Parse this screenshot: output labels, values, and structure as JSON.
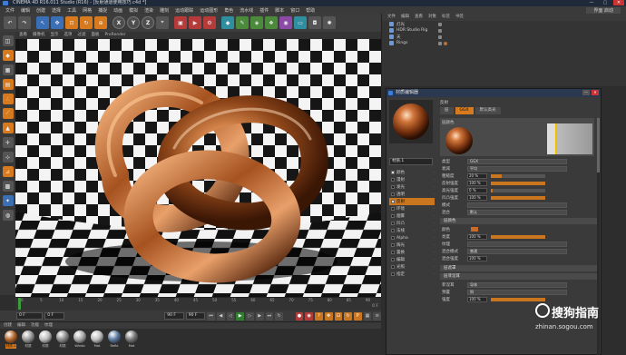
{
  "app": {
    "title": "CINEMA 4D R16.011 Studio (R16) - [反射通道使用技巧.c4d *]",
    "win_buttons": [
      "—",
      "▢",
      "✕"
    ]
  },
  "menu": {
    "items": [
      "文件",
      "编辑",
      "创建",
      "选择",
      "工具",
      "网格",
      "捕捉",
      "动画",
      "模拟",
      "渲染",
      "雕刻",
      "运动跟踪",
      "运动图形",
      "角色",
      "流水线",
      "插件",
      "脚本",
      "窗口",
      "帮助"
    ],
    "layout_label": "界面",
    "layout_value": "启动"
  },
  "toolbar": {
    "axis_x": "X",
    "axis_y": "Y",
    "axis_z": "Z"
  },
  "viewport": {
    "menu": [
      "查看",
      "摄像机",
      "显示",
      "选项",
      "过滤",
      "面板",
      "ProRender"
    ]
  },
  "timeline": {
    "ticks": [
      "0",
      "5",
      "10",
      "15",
      "20",
      "25",
      "30",
      "35",
      "40",
      "45",
      "50",
      "55",
      "60",
      "65",
      "70",
      "75",
      "80",
      "85",
      "90"
    ],
    "end_label": "0 F"
  },
  "transport": {
    "start": "0 F",
    "current": "0 F",
    "end": "90 F",
    "end2": "90 F"
  },
  "materials": {
    "menu": [
      "创建",
      "编辑",
      "功能",
      "纹理"
    ],
    "items": [
      {
        "label": "材质.1",
        "color": "#b5672a",
        "selected": true
      },
      {
        "label": "材质",
        "color": "#9a9a9a",
        "selected": false
      },
      {
        "label": "材质",
        "color": "#bdbdbd",
        "selected": false
      },
      {
        "label": "材质",
        "color": "#8c8c8c",
        "selected": false
      },
      {
        "label": "Windo",
        "color": "#a8a8a8",
        "selected": false
      },
      {
        "label": "Mat",
        "color": "#c0c0c0",
        "selected": false
      },
      {
        "label": "Refle",
        "color": "#5a7aa0",
        "selected": false
      },
      {
        "label": "Mat",
        "color": "#777777",
        "selected": false
      }
    ]
  },
  "objects": {
    "menu": [
      "文件",
      "编辑",
      "查看",
      "对象",
      "标签",
      "书签"
    ],
    "rows": [
      {
        "label": "灯光"
      },
      {
        "label": "HDR Studio Rig"
      },
      {
        "label": "天"
      },
      {
        "label": "Rings"
      }
    ]
  },
  "material_editor": {
    "title": "材质编辑器",
    "material_name": "材质.1",
    "channels": [
      {
        "label": "颜色",
        "on": true,
        "sel": false
      },
      {
        "label": "漫射",
        "on": false,
        "sel": false
      },
      {
        "label": "发光",
        "on": false,
        "sel": false
      },
      {
        "label": "透明",
        "on": false,
        "sel": false
      },
      {
        "label": "反射",
        "on": true,
        "sel": true
      },
      {
        "label": "环境",
        "on": false,
        "sel": false
      },
      {
        "label": "烟雾",
        "on": false,
        "sel": false
      },
      {
        "label": "凹凸",
        "on": false,
        "sel": false
      },
      {
        "label": "法线",
        "on": false,
        "sel": false
      },
      {
        "label": "Alpha",
        "on": false,
        "sel": false
      },
      {
        "label": "辉光",
        "on": false,
        "sel": false
      },
      {
        "label": "置换",
        "on": false,
        "sel": false
      },
      {
        "label": "编辑",
        "on": false,
        "sel": false
      },
      {
        "label": "光照",
        "on": false,
        "sel": false
      },
      {
        "label": "指定",
        "on": false,
        "sel": false
      }
    ],
    "attr_title": "反射",
    "tabs": [
      "层",
      "GGX",
      "默认高光"
    ],
    "layer_label": "层颜色",
    "rows": {
      "type_label": "类型",
      "type_value": "GGX",
      "atten_label": "衰减",
      "atten_value": "平均",
      "rough_label": "粗糙度",
      "rough_value": "20 %",
      "refl_label": "反射强度",
      "refl_value": "100 %",
      "spec_label": "高光强度",
      "spec_value": "0 %",
      "bump_label": "凹凸强度",
      "bump_value": "100 %",
      "mode_label": "模式",
      "mode_value": "",
      "mix_label": "混合",
      "mix_value": "默认",
      "color_section": "层颜色",
      "color_label": "颜色",
      "bright_label": "亮度",
      "bright_value": "100 %",
      "tex_label": "纹理",
      "mixmode_label": "混合模式",
      "mixmode_value": "普通",
      "mixstr_label": "混合强度",
      "mixstr_value": "100 %",
      "mask_section": "层遮罩",
      "fresnel_section": "层菲涅耳",
      "fres_label": "菲涅耳",
      "fres_value": "导体",
      "preset_label": "预置",
      "preset_value": "铜",
      "fstr_label": "强度",
      "fstr_value": "100 %"
    }
  },
  "watermark": {
    "text": "搜狗指南",
    "url": "zhinan.sogou.com"
  }
}
